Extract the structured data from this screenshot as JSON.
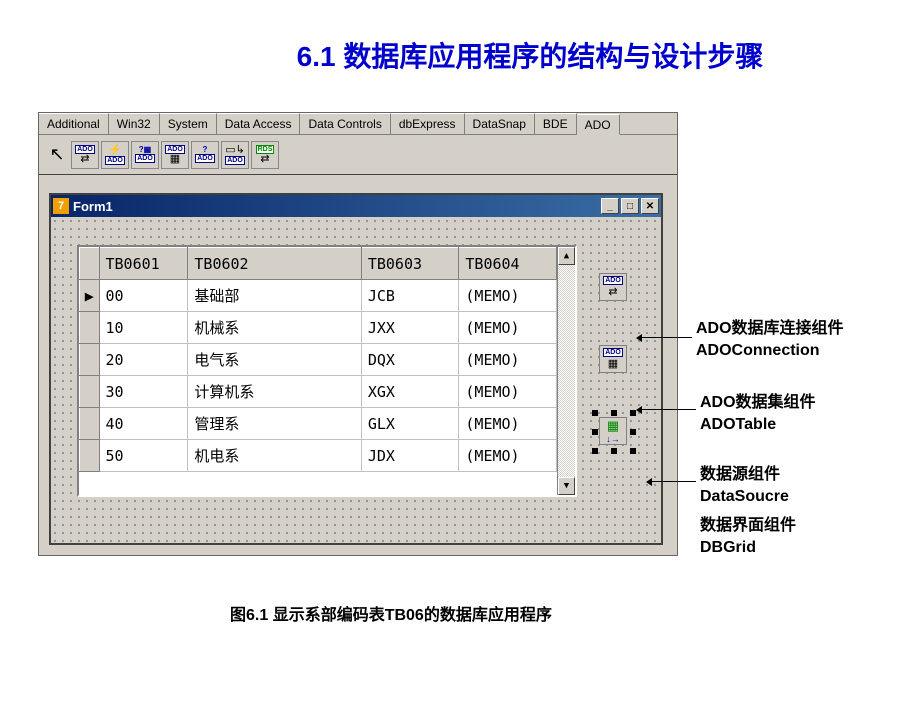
{
  "title": "6.1 数据库应用程序的结构与设计步骤",
  "palette_tabs": [
    "Additional",
    "Win32",
    "System",
    "Data Access",
    "Data Controls",
    "dbExpress",
    "DataSnap",
    "BDE",
    "ADO"
  ],
  "palette_active_tab": "ADO",
  "form": {
    "title": "Form1"
  },
  "grid": {
    "headers": [
      "TB0601",
      "TB0602",
      "TB0603",
      "TB0604"
    ],
    "rows": [
      {
        "c1": "00",
        "c2": "基础部",
        "c3": "JCB",
        "c4": "(MEMO)"
      },
      {
        "c1": "10",
        "c2": "机械系",
        "c3": "JXX",
        "c4": "(MEMO)"
      },
      {
        "c1": "20",
        "c2": "电气系",
        "c3": "DQX",
        "c4": "(MEMO)"
      },
      {
        "c1": "30",
        "c2": "计算机系",
        "c3": "XGX",
        "c4": "(MEMO)"
      },
      {
        "c1": "40",
        "c2": "管理系",
        "c3": "GLX",
        "c4": "(MEMO)"
      },
      {
        "c1": "50",
        "c2": "机电系",
        "c3": "JDX",
        "c4": "(MEMO)"
      }
    ]
  },
  "annotations": {
    "adoconn_l1": "ADO数据库连接组件",
    "adoconn_l2": "ADOConnection",
    "adotable_l1": "ADO数据集组件",
    "adotable_l2": "ADOTable",
    "datasource_l1": "数据源组件",
    "datasource_l2": "DataSoucre",
    "dbgrid_l1": "数据界面组件",
    "dbgrid_l2": "DBGrid"
  },
  "caption": "图6.1 显示系部编码表TB06的数据库应用程序"
}
